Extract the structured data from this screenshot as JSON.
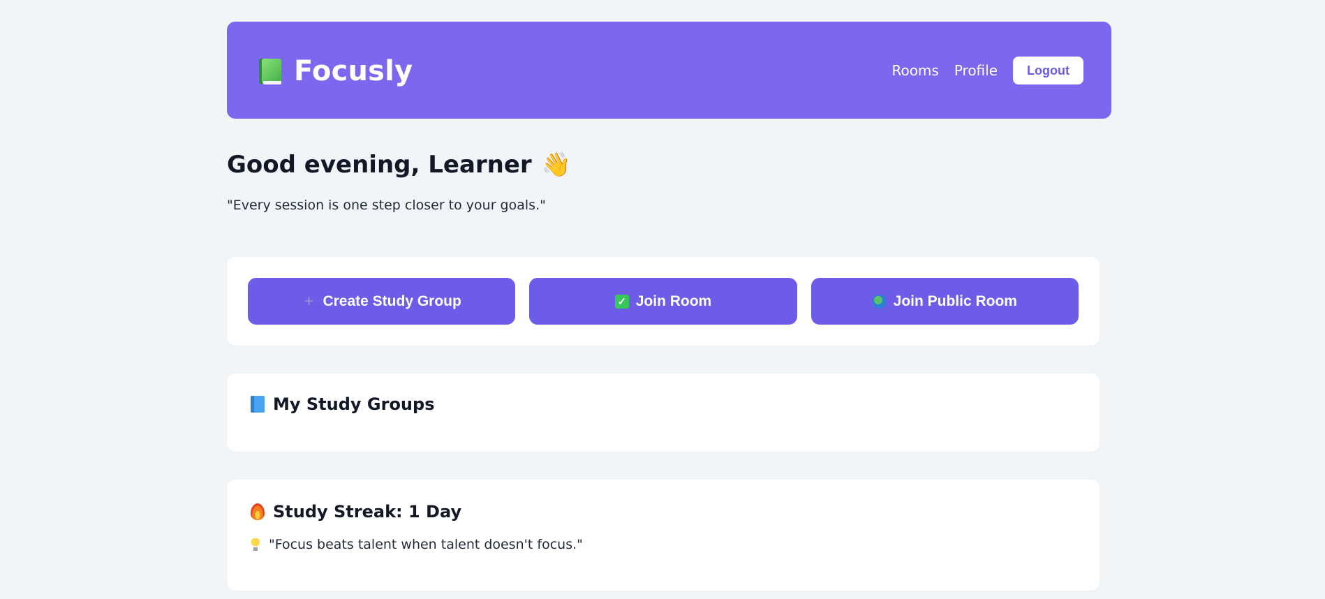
{
  "colors": {
    "background": "#f2f5f8",
    "header": "#7b68ee",
    "primary_button": "#6c5ce7",
    "card": "#ffffff",
    "logout_text": "#6a5ae0"
  },
  "header": {
    "brand_icon": "green-book-icon",
    "brand_name": "Focusly",
    "nav": {
      "rooms": "Rooms",
      "profile": "Profile",
      "logout": "Logout"
    }
  },
  "greeting": {
    "title": "Good evening, Learner",
    "icon": "waving-hand-icon",
    "wave_glyph": "👋",
    "quote": "\"Every session is one step closer to your goals.\""
  },
  "actions": {
    "create": {
      "icon": "plus-icon",
      "glyph": "+",
      "label": "Create Study Group"
    },
    "join": {
      "icon": "check-icon",
      "glyph": "✓",
      "label": "Join Room"
    },
    "public": {
      "icon": "globe-icon",
      "label": "Join Public Room"
    }
  },
  "groups": {
    "icon": "blue-book-icon",
    "title": "My Study Groups"
  },
  "streak": {
    "icon": "fire-icon",
    "title": "Study Streak: 1 Day",
    "tip_icon": "light-bulb-icon",
    "tip": "\"Focus beats talent when talent doesn't focus.\""
  }
}
